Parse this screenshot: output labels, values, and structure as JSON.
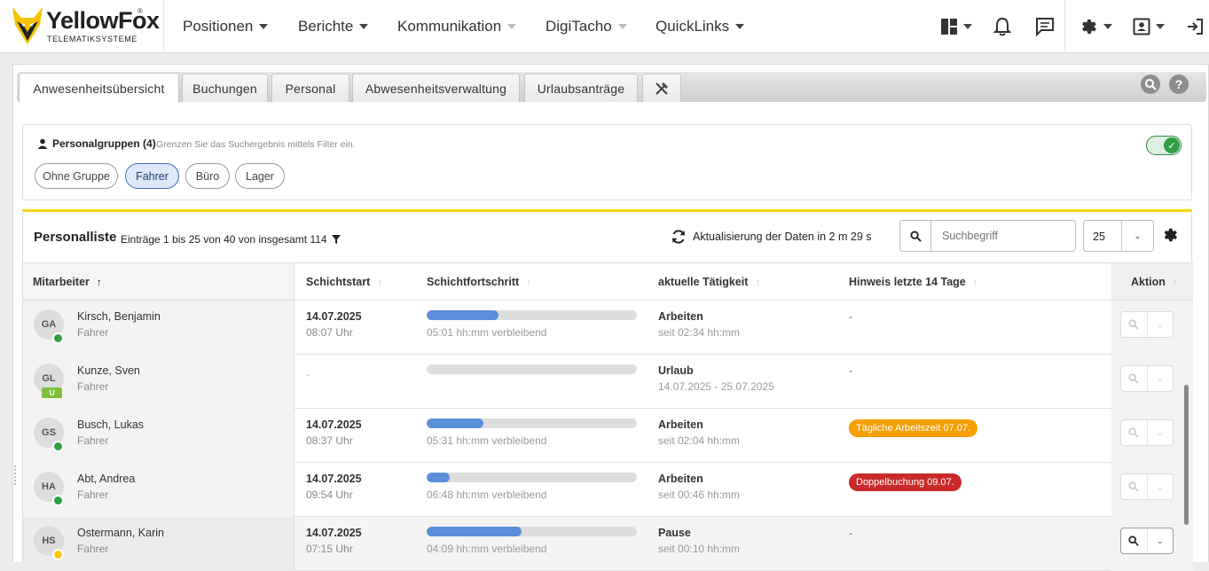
{
  "brand": {
    "name": "YellowFox",
    "tagline": "TELEMATIKSYSTEME",
    "reg": "®"
  },
  "nav": [
    {
      "label": "Positionen",
      "enabled": true
    },
    {
      "label": "Berichte",
      "enabled": true
    },
    {
      "label": "Kommunikation",
      "enabled": false
    },
    {
      "label": "DigiTacho",
      "enabled": false
    },
    {
      "label": "QuickLinks",
      "enabled": true
    }
  ],
  "tabs": [
    "Anwesenheitsübersicht",
    "Buchungen",
    "Personal",
    "Abwesenheitsverwaltung",
    "Urlaubsanträge"
  ],
  "filter": {
    "title": "Personalgruppen (4)",
    "hint": "Grenzen Sie das Suchergebnis mittels Filter ein.",
    "chips": [
      "Ohne Gruppe",
      "Fahrer",
      "Büro",
      "Lager"
    ],
    "active_chip": "Fahrer"
  },
  "list": {
    "title": "Personalliste",
    "count": "Einträge 1 bis 25 von 40 von insgesamt 114",
    "refresh": "Aktualisierung der Daten in 2 m 29 s",
    "search_placeholder": "Suchbegriff",
    "page_size": "25"
  },
  "columns": {
    "employee": "Mitarbeiter",
    "shift_start": "Schichtstart",
    "shift_progress": "Schichtfortschritt",
    "activity": "aktuelle Tätigkeit",
    "hint": "Hinweis letzte 14 Tage",
    "action": "Aktion"
  },
  "rows": [
    {
      "initials": "GA",
      "status": "green",
      "name": "Kirsch, Benjamin",
      "role": "Fahrer",
      "date": "14.07.2025",
      "time": "08:07 Uhr",
      "progress": 0.34,
      "remaining": "05:01 hh:mm verbleibend",
      "activity": "Arbeiten",
      "since": "seit 02:34 hh:mm",
      "hint": "-",
      "hint_color": ""
    },
    {
      "initials": "GL",
      "status": "U",
      "name": "Kunze, Sven",
      "role": "Fahrer",
      "date": "-",
      "time": "",
      "progress": 0,
      "remaining": "",
      "activity": "Urlaub",
      "since": "14.07.2025 - 25.07.2025",
      "hint": "-",
      "hint_color": ""
    },
    {
      "initials": "GS",
      "status": "green",
      "name": "Busch, Lukas",
      "role": "Fahrer",
      "date": "14.07.2025",
      "time": "08:37 Uhr",
      "progress": 0.27,
      "remaining": "05:31 hh:mm verbleibend",
      "activity": "Arbeiten",
      "since": "seit 02:04 hh:mm",
      "hint": "Tägliche Arbeitszeit 07.07.",
      "hint_color": "#f59f00"
    },
    {
      "initials": "HA",
      "status": "green",
      "name": "Abt, Andrea",
      "role": "Fahrer",
      "date": "14.07.2025",
      "time": "09:54 Uhr",
      "progress": 0.11,
      "remaining": "06:48 hh:mm verbleibend",
      "activity": "Arbeiten",
      "since": "seit 00:46 hh:mm",
      "hint": "Doppelbuchung 09.07.",
      "hint_color": "#c92a2a"
    },
    {
      "initials": "HS",
      "status": "yellow",
      "name": "Ostermann, Karin",
      "role": "Fahrer",
      "date": "14.07.2025",
      "time": "07:15 Uhr",
      "progress": 0.45,
      "remaining": "04:09 hh:mm verbleibend",
      "activity": "Pause",
      "since": "seit 00:10 hh:mm",
      "hint": "-",
      "hint_color": ""
    }
  ],
  "colors": {
    "accent": "#f5d30f",
    "progress": "#5b8fd9",
    "status_green": "#2f9e44",
    "status_yellow": "#fcc419"
  },
  "icons": [
    "dashboard-icon",
    "bell-icon",
    "message-icon",
    "gear-icon",
    "contact-icon",
    "logout-icon",
    "tools-icon",
    "search-icon",
    "refresh-icon",
    "filter-icon",
    "user-icon",
    "help-icon"
  ]
}
